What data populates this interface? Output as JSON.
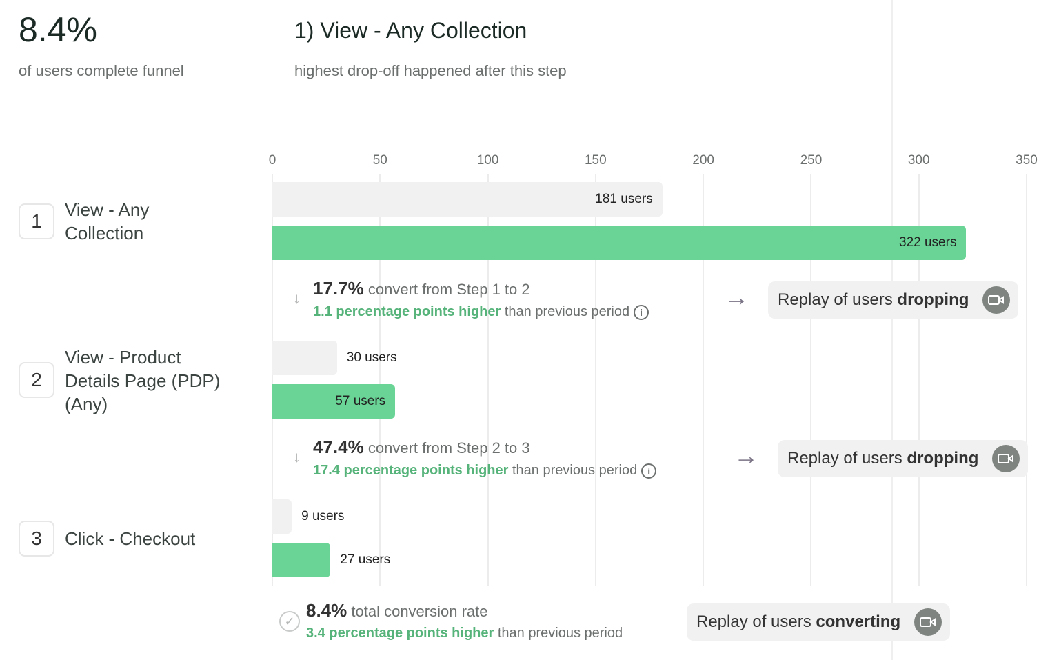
{
  "summary": {
    "completion_rate": "8.4%",
    "completion_label": "of users complete funnel",
    "dropoff_step": "1) View - Any Collection",
    "dropoff_label": "highest drop-off happened after this step"
  },
  "chart_data": {
    "type": "bar",
    "orientation": "horizontal",
    "xlim": [
      0,
      350
    ],
    "ticks": [
      "0",
      "50",
      "100",
      "150",
      "200",
      "250",
      "300",
      "350"
    ],
    "grid": true,
    "categories": [
      "View - Any Collection",
      "View - Product Details Page (PDP) (Any)",
      "Click - Checkout"
    ],
    "series": [
      {
        "values": [
          181,
          30,
          9
        ],
        "color": "#f0f1f0"
      },
      {
        "values": [
          322,
          57,
          27
        ],
        "color": "#69d495"
      }
    ],
    "labels": [
      [
        "181 users",
        "322 users"
      ],
      [
        "30 users",
        "57 users"
      ],
      [
        "9 users",
        "27 users"
      ]
    ]
  },
  "steps": [
    {
      "num": "1",
      "label": "View - Any Collection"
    },
    {
      "num": "2",
      "label": "View - Product Details Page (PDP) (Any)"
    },
    {
      "num": "3",
      "label": "Click - Checkout"
    }
  ],
  "conversions": [
    {
      "pct": "17.7%",
      "text": "convert from Step 1 to 2",
      "delta": "1.1 percentage points higher",
      "rest": "than previous period",
      "replay": "Replay of users ",
      "replay_bold": "dropping"
    },
    {
      "pct": "47.4%",
      "text": "convert from Step 2 to 3",
      "delta": "17.4 percentage points higher",
      "rest": "than previous period",
      "replay": "Replay of users ",
      "replay_bold": "dropping"
    }
  ],
  "total": {
    "pct": "8.4%",
    "text": "total conversion rate",
    "delta": "3.4 percentage points higher",
    "rest": "than previous period",
    "replay": "Replay of users ",
    "replay_bold": "converting"
  },
  "colors": {
    "current": "#69d495",
    "previous": "#f0f1f0",
    "positive": "#56b37a"
  }
}
